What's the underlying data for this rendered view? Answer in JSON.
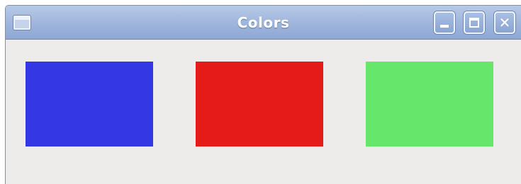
{
  "window": {
    "title": "Colors",
    "menu_icon": "window-menu-icon",
    "controls": {
      "minimize_icon": "minimize-icon",
      "maximize_icon": "maximize-icon",
      "close_icon": "close-icon",
      "close_glyph": "✕"
    }
  },
  "swatches": [
    {
      "color": "#3438e4"
    },
    {
      "color": "#e51b19"
    },
    {
      "color": "#66e66a"
    }
  ]
}
